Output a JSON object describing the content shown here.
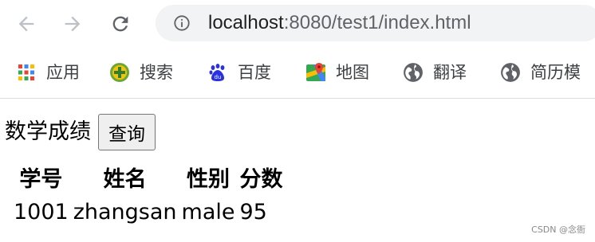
{
  "browser": {
    "url_host": "localhost",
    "url_rest": ":8080/test1/index.html",
    "nav_icons": [
      "back-arrow-icon",
      "forward-arrow-icon",
      "reload-icon",
      "info-icon"
    ],
    "bookmarks": [
      {
        "label": "应用",
        "icon": "apps-grid-icon"
      },
      {
        "label": "搜索",
        "icon": "search-plus-icon"
      },
      {
        "label": "百度",
        "icon": "baidu-paw-icon"
      },
      {
        "label": "地图",
        "icon": "maps-pin-icon"
      },
      {
        "label": "翻译",
        "icon": "globe-icon"
      },
      {
        "label": "简历模",
        "icon": "globe-icon"
      }
    ]
  },
  "page": {
    "title": "数学成绩",
    "query_button": "查询",
    "table": {
      "headers": [
        "学号",
        "姓名",
        "性别",
        "分数"
      ],
      "rows": [
        [
          "1001",
          "zhangsan",
          "male",
          "95"
        ]
      ]
    }
  },
  "watermark": "CSDN @念衙",
  "colors": {
    "omnibox_bg": "#f1f3f4",
    "icon_gray": "#5f6368",
    "text_dark": "#202124"
  }
}
